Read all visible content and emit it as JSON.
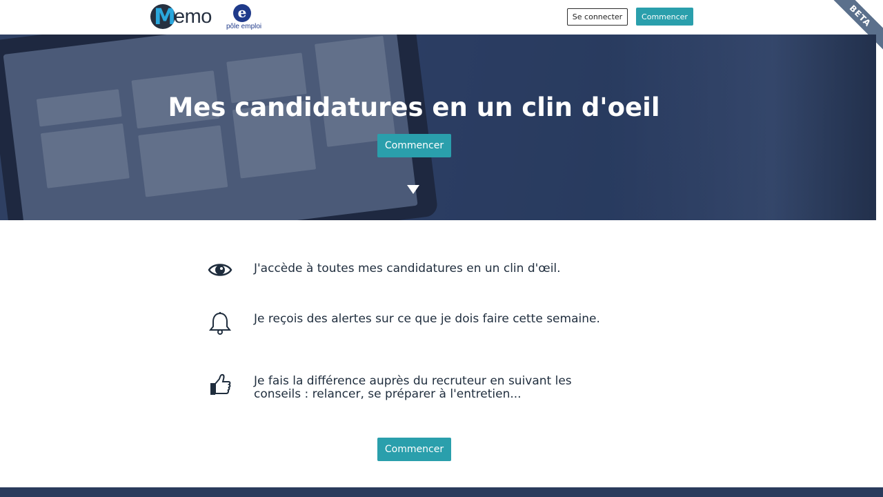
{
  "header": {
    "logo_text": "Memo",
    "logo_letter": "M",
    "partner_logo_letter": "e",
    "partner_logo_text": "pôle emploi",
    "login_label": "Se connecter",
    "start_label": "Commencer",
    "beta_label": "BETA"
  },
  "hero": {
    "title": "Mes candidatures en un clin d'oeil",
    "cta_label": "Commencer",
    "scroll_icon": "triangle-down-icon"
  },
  "features": [
    {
      "icon": "eye-icon",
      "text": "J'accède à toutes mes candidatures en un clin d'œil."
    },
    {
      "icon": "bell-icon",
      "text": "Je reçois des alertes sur ce que je dois faire cette semaine."
    },
    {
      "icon": "thumbs-up-icon",
      "text": "Je fais la différence auprès du recruteur en suivant les conseils : relancer, se préparer à l'entretien..."
    }
  ],
  "bottom_cta_label": "Commencer",
  "colors": {
    "accent": "#2a9fac",
    "navy": "#2a3b5c",
    "text": "#1f2d3d",
    "beta_ribbon": "#5b708c"
  }
}
